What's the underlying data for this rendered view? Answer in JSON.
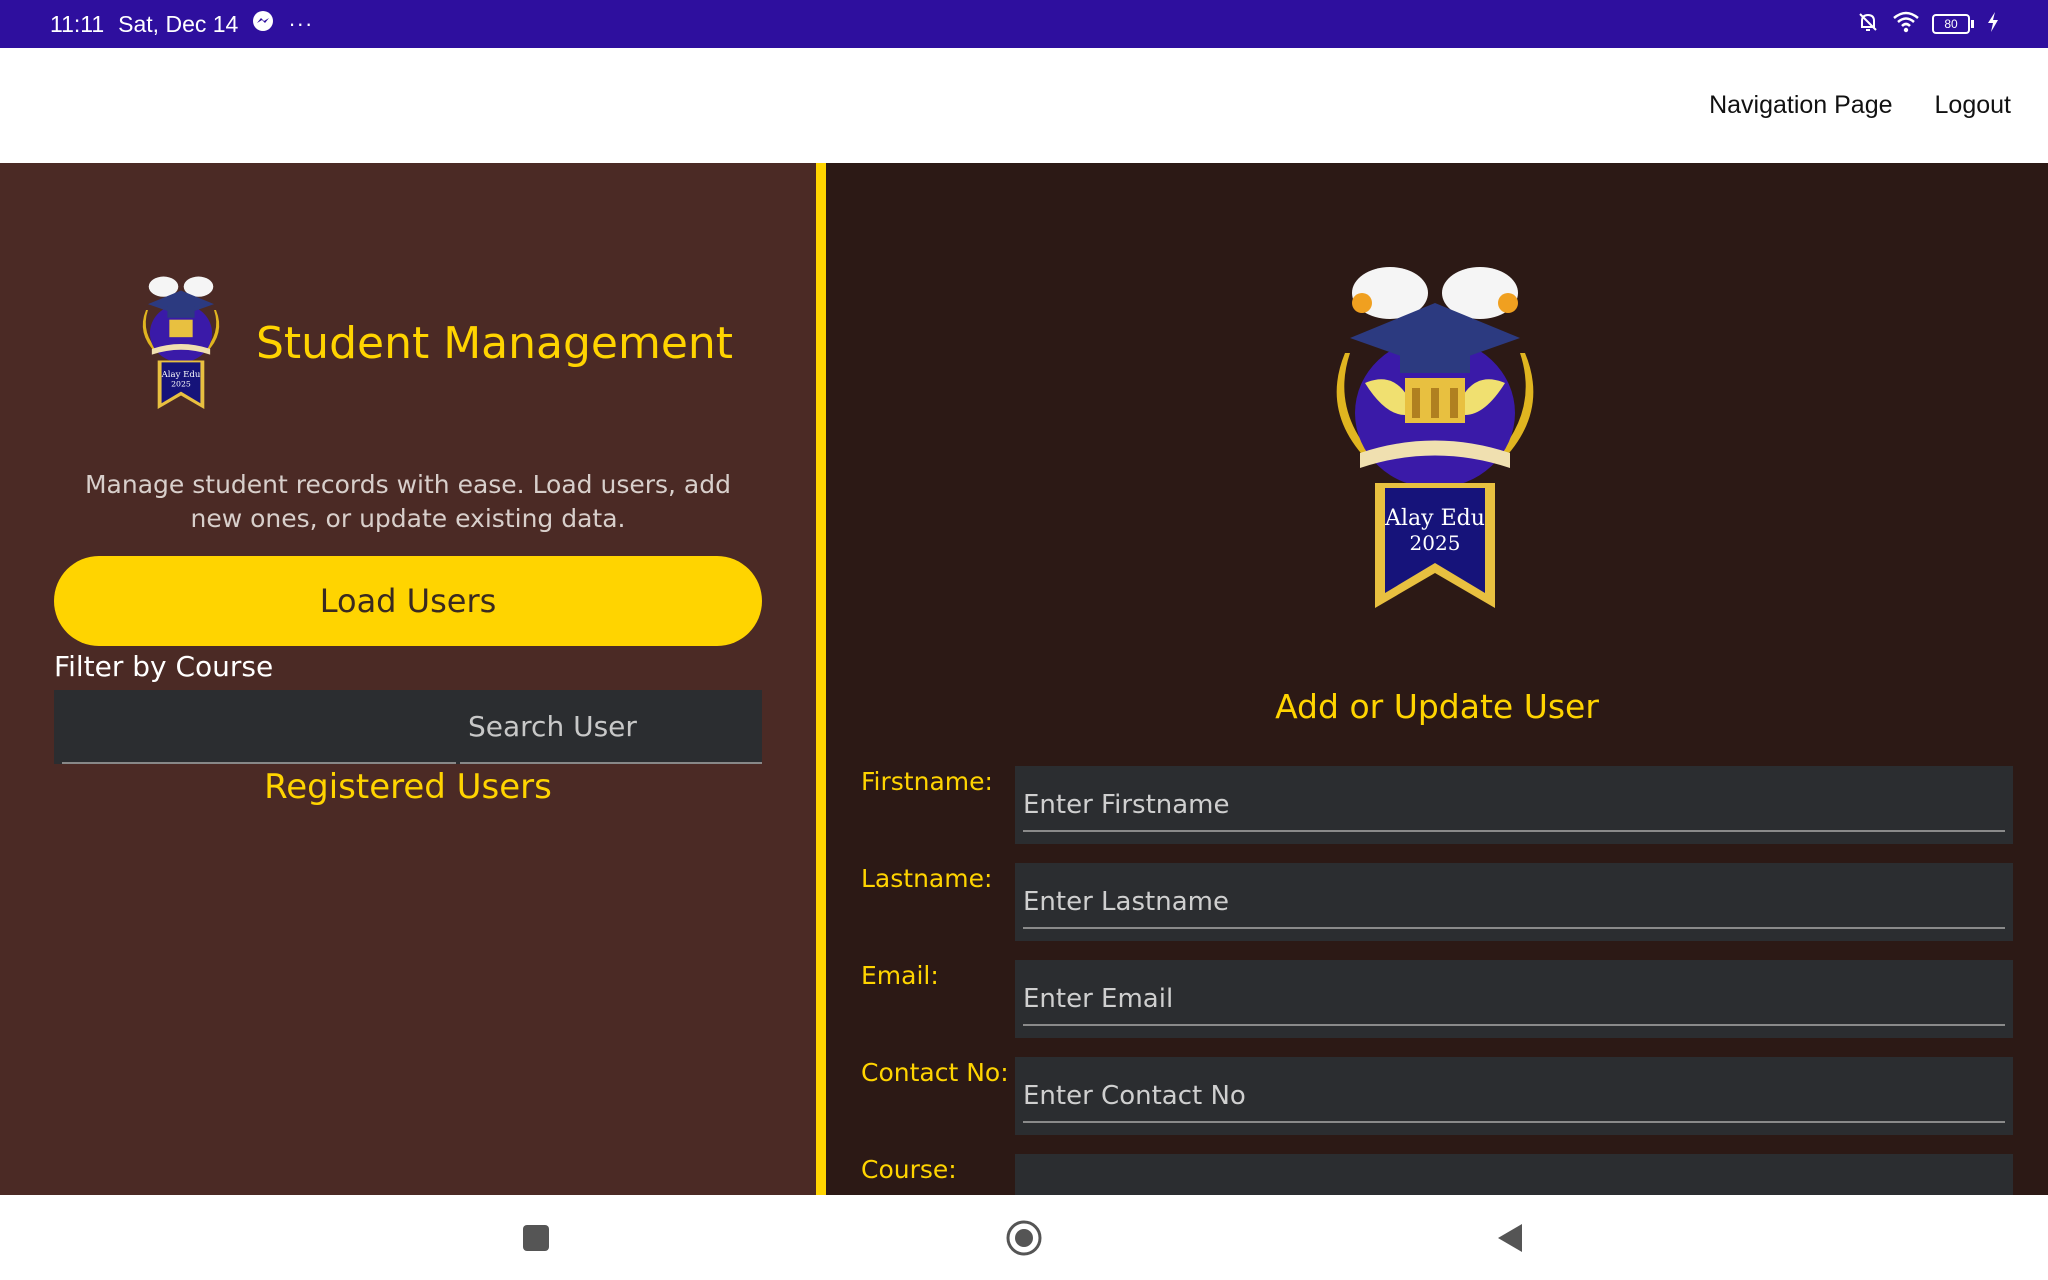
{
  "status_bar": {
    "time": "11:11",
    "date": "Sat, Dec 14",
    "app_icons": [
      "messenger-icon",
      "more-dots-icon"
    ],
    "system_icons": [
      "bell-off-icon",
      "wifi-icon",
      "battery-icon",
      "charging-icon"
    ],
    "battery_level": "80",
    "background_color": "#2e0f9e"
  },
  "app_bar": {
    "links": [
      "Navigation Page",
      "Logout"
    ]
  },
  "left_panel": {
    "title": "Student Management",
    "description": "Manage student records with ease. Load users, add new ones, or update existing data.",
    "load_button": "Load Users",
    "filter_label": "Filter by Course",
    "course_filter_value": "",
    "search_placeholder": "Search User",
    "registered_title": "Registered Users",
    "logo_text_line1": "Alay Edu",
    "logo_text_line2": "2025"
  },
  "right_panel": {
    "logo_text_line1": "Alay Edu",
    "logo_text_line2": "2025",
    "form_title": "Add or Update User",
    "fields": [
      {
        "label": "Firstname:",
        "placeholder": "Enter Firstname"
      },
      {
        "label": "Lastname:",
        "placeholder": "Enter Lastname"
      },
      {
        "label": "Email:",
        "placeholder": "Enter Email"
      },
      {
        "label": "Contact No:",
        "placeholder": "Enter Contact No"
      },
      {
        "label": "Course:",
        "placeholder": ""
      }
    ]
  },
  "colors": {
    "accent": "#ffd400",
    "left_panel_bg": "#4b2a25",
    "right_panel_bg": "#2c1915",
    "input_bg": "#2b2d30"
  },
  "nav_bar": {
    "buttons": [
      "recent-apps-icon",
      "home-icon",
      "back-icon"
    ]
  }
}
